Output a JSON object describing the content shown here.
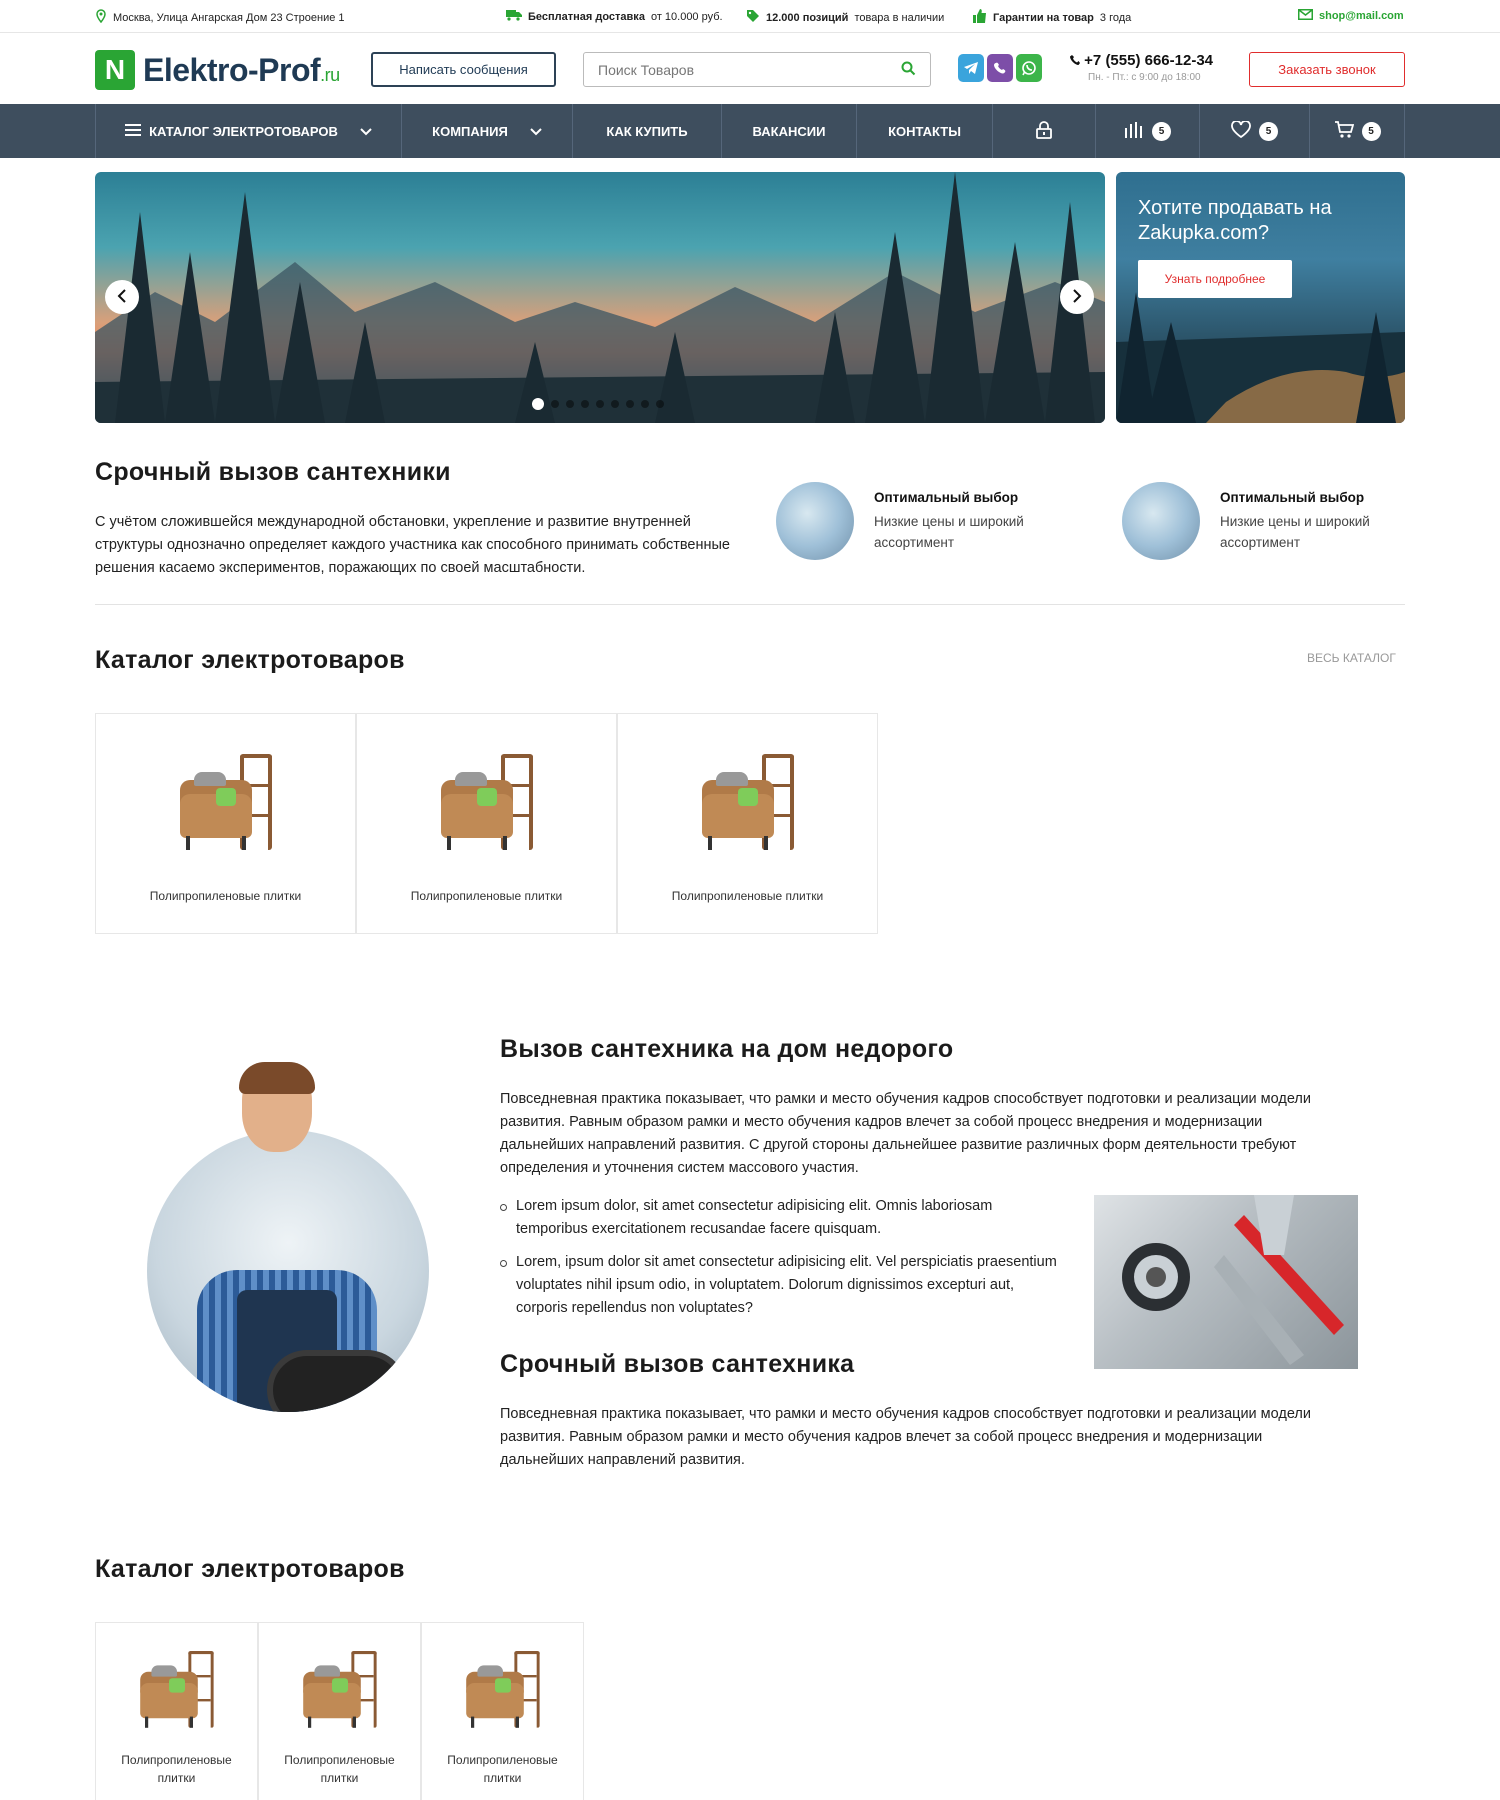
{
  "topbar": {
    "address": "Москва, Улица Ангарская Дом 23 Строение 1",
    "delivery_bold": "Бесплатная доставка",
    "delivery_rest": "от 10.000 руб.",
    "stock_bold": "12.000 позиций",
    "stock_rest": "товара в наличии",
    "guarantee_bold": "Гарантии на товар",
    "guarantee_rest": "3 года",
    "email": "shop@mail.com"
  },
  "header": {
    "logo_main": "Elektro-Prof",
    "logo_suffix": ".ru",
    "logo_letter": "N",
    "write_button": "Написать сообщения",
    "search_placeholder": "Поиск Товаров",
    "phone": "+7 (555) 666-12-34",
    "phone_hours": "Пн. - Пт.: с 9:00 до 18:00",
    "call_button": "Заказать звонок"
  },
  "nav": {
    "items": [
      "КАТАЛОГ ЭЛЕКТРОТОВАРОВ",
      "КОМПАНИЯ",
      "КАК КУПИТЬ",
      "ВАКАНСИИ",
      "КОНТАКТЫ"
    ],
    "compare_count": "5",
    "favorites_count": "5",
    "cart_count": "5"
  },
  "hero": {
    "slide_count": 9,
    "active_slide": 1
  },
  "side_banner": {
    "title": "Хотите продавать на Zakupka.com?",
    "button": "Узнать подробнее"
  },
  "info": {
    "title": "Срочный вызов сантехники",
    "text": "С учётом сложившейся международной обстановки, укрепление и развитие внутренней структуры однозначно определяет каждого участника как способного принимать собственные решения касаемо экспериментов, поражающих по своей масштабности.",
    "features": [
      {
        "title": "Оптимальный выбор",
        "desc": "Низкие цены и широкий ассортимент"
      },
      {
        "title": "Оптимальный выбор",
        "desc": "Низкие цены и широкий ассортимент"
      }
    ]
  },
  "catalog1": {
    "title": "Каталог электротоваров",
    "all_link": "ВЕСЬ КАТАЛОГ",
    "items": [
      "Полипропиленовые плитки",
      "Полипропиленовые плитки",
      "Полипропиленовые плитки"
    ]
  },
  "about": {
    "title": "Вызов сантехника на дом недорого",
    "text": "Повседневная практика показывает, что рамки и место обучения кадров способствует подготовки и реализации модели развития. Равным образом рамки и место обучения кадров влечет за собой процесс внедрения и модернизации дальнейших направлений развития. С другой стороны дальнейшее развитие различных форм деятельности требуют определения и уточнения систем массового участия.",
    "bullets": [
      "Lorem ipsum dolor, sit amet consectetur adipisicing elit. Omnis laboriosam temporibus exercitationem recusandae facere quisquam.",
      "Lorem, ipsum dolor sit amet consectetur adipisicing elit. Vel perspiciatis praesentium voluptates nihil ipsum odio, in voluptatem. Dolorum dignissimos excepturi aut, corporis repellendus non voluptates?"
    ],
    "subtitle": "Срочный вызов сантехника",
    "text2": "Повседневная практика показывает, что рамки и место обучения кадров способствует подготовки и реализации модели развития. Равным образом рамки и место обучения кадров влечет за собой процесс внедрения и модернизации дальнейших направлений развития."
  },
  "catalog2": {
    "title": "Каталог электротоваров",
    "items": [
      "Полипропиленовые плитки",
      "Полипропиленовые плитки",
      "Полипропиленовые плитки"
    ]
  }
}
